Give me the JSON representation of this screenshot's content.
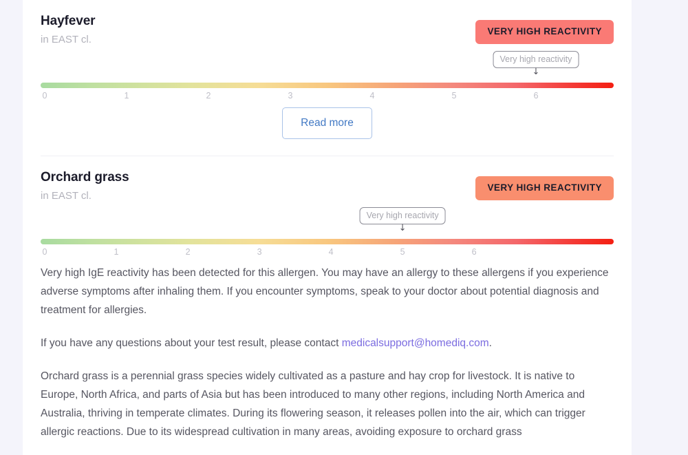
{
  "theme": {
    "page_background": "#f4f4fb",
    "card_background": "#ffffff",
    "link_color": "#7b6ce0",
    "button_border_color": "#a9c2e8",
    "button_text_color": "#4279c4",
    "body_text_color": "#565661",
    "title_color": "#1c1c2b",
    "subtitle_color": "#b2b2bb",
    "tick_label_color": "#bfbfc8",
    "scale_gradient_start": "#a8dba0",
    "scale_gradient_end": "#f41f12"
  },
  "allergens": [
    {
      "name": "Hayfever",
      "subtitle": "in EAST cl.",
      "badge": {
        "label": "VERY HIGH REACTIVITY",
        "background": "#fa7a75",
        "text_color": "#1c1c2b"
      },
      "scale": {
        "ticks": [
          "0",
          "1",
          "2",
          "3",
          "4",
          "5",
          "6"
        ],
        "min": 0,
        "max": 6.95,
        "marker_value": 6,
        "marker_label": "Very high reactivity",
        "marker_arrow": "↓"
      },
      "read_more_label": "Read more"
    },
    {
      "name": "Orchard grass",
      "subtitle": "in EAST cl.",
      "badge": {
        "label": "VERY HIGH REACTIVITY",
        "background": "#f98e6e",
        "text_color": "#1c1c2b"
      },
      "scale": {
        "ticks": [
          "0",
          "1",
          "2",
          "3",
          "4",
          "5",
          "6"
        ],
        "min": 0,
        "max": 7.95,
        "marker_value": 5,
        "marker_label": "Very high reactivity",
        "marker_arrow": "↓"
      },
      "paragraphs": [
        "Very high IgE reactivity has been detected for this allergen. You may have an allergy to these allergens if you experience adverse symptoms after inhaling them. If you encounter symptoms, speak to your doctor about potential diagnosis and treatment for allergies.",
        "Orchard grass is a perennial grass species widely cultivated as a pasture and hay crop for livestock. It is native to Europe, North Africa, and parts of Asia but has been introduced to many other regions, including North America and Australia, thriving in temperate climates. During its flowering season, it releases pollen into the air, which can trigger allergic reactions. Due to its widespread cultivation in many areas, avoiding exposure to orchard grass"
      ],
      "contact": {
        "prefix": "If you have any questions about your test result, please contact ",
        "email": "medicalsupport@homediq.com",
        "suffix": "."
      }
    }
  ]
}
